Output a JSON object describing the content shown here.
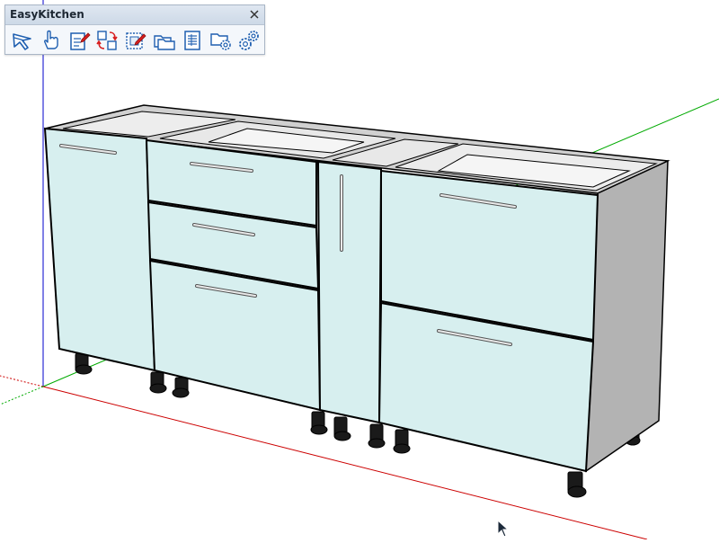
{
  "toolbar": {
    "title": "EasyKitchen",
    "close_icon": "close-icon",
    "tools": [
      {
        "name": "select-tool",
        "icon": "arrow-pointer-icon"
      },
      {
        "name": "pan-tool",
        "icon": "hand-pointer-icon"
      },
      {
        "name": "edit-properties-tool",
        "icon": "edit-document-icon"
      },
      {
        "name": "swap-tool",
        "icon": "swap-arrows-icon"
      },
      {
        "name": "edit-selection-tool",
        "icon": "edit-selection-icon"
      },
      {
        "name": "library-tool",
        "icon": "folders-icon"
      },
      {
        "name": "report-tool",
        "icon": "spreadsheet-icon"
      },
      {
        "name": "folder-settings-tool",
        "icon": "folder-gear-icon"
      },
      {
        "name": "settings-tool",
        "icon": "gears-icon"
      }
    ]
  },
  "colors": {
    "door_face": "#d7efef",
    "carcass_side": "#b3b3b3",
    "carcass_top": "#d0d0d0",
    "axis_red": "#cc0000",
    "axis_green": "#00aa00",
    "axis_blue": "#0000cc",
    "toolbar_accent_blue": "#1f5fb0",
    "toolbar_accent_red": "#d81f1f"
  }
}
